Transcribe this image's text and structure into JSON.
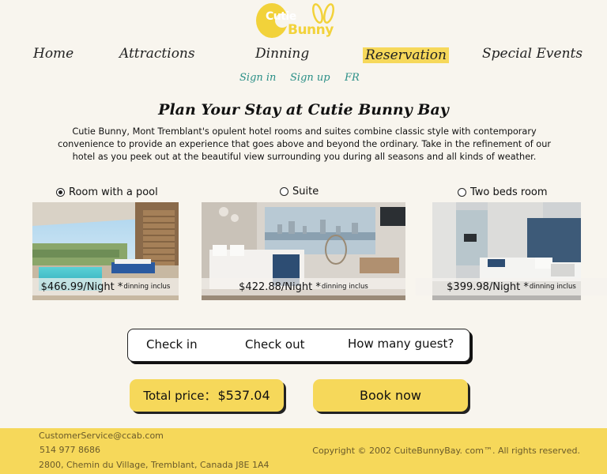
{
  "brand": {
    "line1": "Cutie",
    "line2": "Bunny"
  },
  "nav": {
    "items": [
      {
        "label": "Home"
      },
      {
        "label": "Attractions"
      },
      {
        "label": "Dinning"
      },
      {
        "label": "Reservation",
        "active": true
      },
      {
        "label": "Special Events"
      }
    ],
    "sub": {
      "signin": "Sign in",
      "signup": "Sign up",
      "lang": "FR"
    }
  },
  "page": {
    "title": "Plan Your Stay at Cutie Bunny Bay",
    "intro": "Cutie Bunny, Mont Tremblant's opulent hotel rooms and suites combine classic style with contemporary convenience to provide an experience that goes above and beyond the ordinary. Take in the refinement of our hotel as you peek out at the beautiful view surrounding you during all seasons and all kinds of weather."
  },
  "rooms": [
    {
      "name": "Room with a pool",
      "selected": true,
      "price": "$466.99/Night *",
      "note": "dinning inclus"
    },
    {
      "name": "Suite",
      "selected": false,
      "price": "$422.88/Night *",
      "note": "dinning inclus"
    },
    {
      "name": "Two beds room",
      "selected": false,
      "price": "$399.98/Night *",
      "note": "dinning inclus"
    }
  ],
  "booking": {
    "checkin": "Check in",
    "checkout": "Check out",
    "guests": "How many guest?"
  },
  "total": {
    "label": "Total price：",
    "value": "$537.04"
  },
  "book_label": "Book now",
  "footer": {
    "email": "CustomerService@ccab.com",
    "phone": "514 977 8686",
    "address": "2800, Chemin du Village, Tremblant, Canada J8E 1A4",
    "copyright": "Copyright © 2002 CuiteBunnyBay. com™. All rights reserved."
  },
  "colors": {
    "accent": "#f6d85a",
    "link": "#2a8f87",
    "background": "#f8f5ee"
  }
}
